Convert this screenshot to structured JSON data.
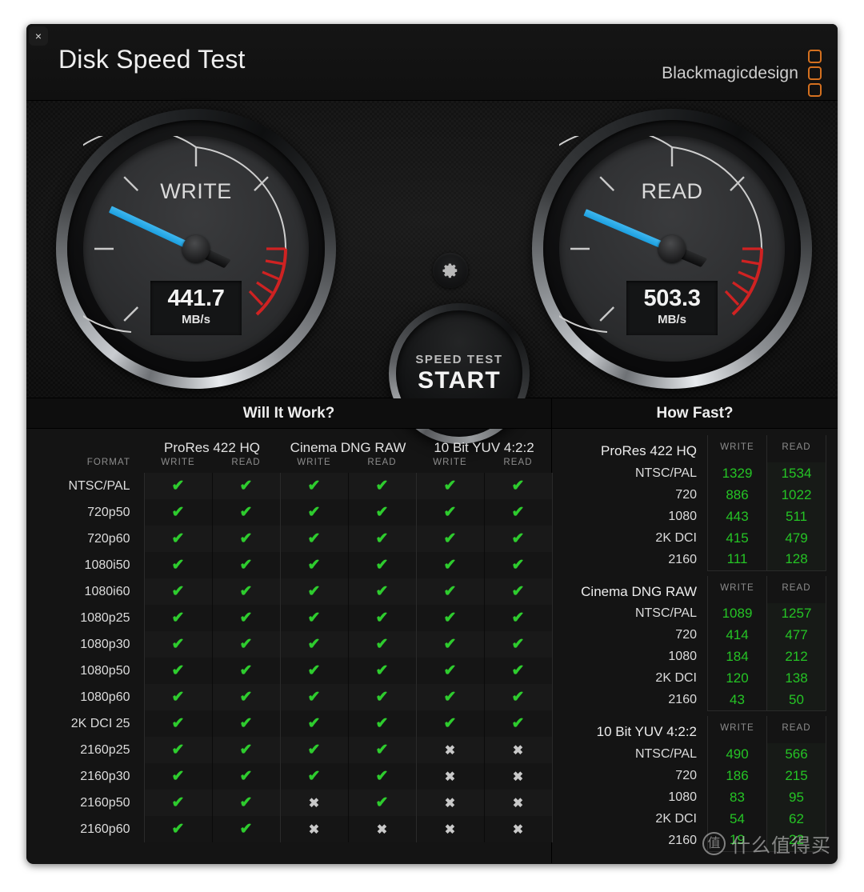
{
  "window": {
    "title": "Disk Speed Test",
    "close_label": "×"
  },
  "brand": {
    "text": "Blackmagicdesign",
    "mark_color": "#d4701f",
    "marks": 3
  },
  "gauges": {
    "write": {
      "label": "WRITE",
      "value": "441.7",
      "unit": "MB/s",
      "needle_angle": 205
    },
    "read": {
      "label": "READ",
      "value": "503.3",
      "unit": "MB/s",
      "needle_angle": 203
    },
    "accent_needle": "#2ba6e0",
    "redzone": "#cf2222"
  },
  "controls": {
    "gear_icon": "gear-icon",
    "start_sub": "SPEED TEST",
    "start_main": "START"
  },
  "will_it_work": {
    "title": "Will It Work?",
    "format_header": "FORMAT",
    "codecs": [
      "ProRes 422 HQ",
      "Cinema DNG RAW",
      "10 Bit YUV 4:2:2"
    ],
    "sub_headers": [
      "WRITE",
      "READ"
    ],
    "ok_glyph": "✔",
    "no_glyph": "✖",
    "rows": [
      {
        "format": "NTSC/PAL",
        "cells": [
          true,
          true,
          true,
          true,
          true,
          true
        ]
      },
      {
        "format": "720p50",
        "cells": [
          true,
          true,
          true,
          true,
          true,
          true
        ]
      },
      {
        "format": "720p60",
        "cells": [
          true,
          true,
          true,
          true,
          true,
          true
        ]
      },
      {
        "format": "1080i50",
        "cells": [
          true,
          true,
          true,
          true,
          true,
          true
        ]
      },
      {
        "format": "1080i60",
        "cells": [
          true,
          true,
          true,
          true,
          true,
          true
        ]
      },
      {
        "format": "1080p25",
        "cells": [
          true,
          true,
          true,
          true,
          true,
          true
        ]
      },
      {
        "format": "1080p30",
        "cells": [
          true,
          true,
          true,
          true,
          true,
          true
        ]
      },
      {
        "format": "1080p50",
        "cells": [
          true,
          true,
          true,
          true,
          true,
          true
        ]
      },
      {
        "format": "1080p60",
        "cells": [
          true,
          true,
          true,
          true,
          true,
          true
        ]
      },
      {
        "format": "2K DCI 25",
        "cells": [
          true,
          true,
          true,
          true,
          true,
          true
        ]
      },
      {
        "format": "2160p25",
        "cells": [
          true,
          true,
          true,
          true,
          false,
          false
        ]
      },
      {
        "format": "2160p30",
        "cells": [
          true,
          true,
          true,
          true,
          false,
          false
        ]
      },
      {
        "format": "2160p50",
        "cells": [
          true,
          true,
          false,
          true,
          false,
          false
        ]
      },
      {
        "format": "2160p60",
        "cells": [
          true,
          true,
          false,
          false,
          false,
          false
        ]
      }
    ]
  },
  "how_fast": {
    "title": "How Fast?",
    "sub_headers": [
      "WRITE",
      "READ"
    ],
    "value_color": "#25c425",
    "sections": [
      {
        "codec": "ProRes 422 HQ",
        "rows": [
          {
            "label": "NTSC/PAL",
            "write": "1329",
            "read": "1534"
          },
          {
            "label": "720",
            "write": "886",
            "read": "1022"
          },
          {
            "label": "1080",
            "write": "443",
            "read": "511"
          },
          {
            "label": "2K DCI",
            "write": "415",
            "read": "479"
          },
          {
            "label": "2160",
            "write": "111",
            "read": "128"
          }
        ]
      },
      {
        "codec": "Cinema DNG RAW",
        "rows": [
          {
            "label": "NTSC/PAL",
            "write": "1089",
            "read": "1257"
          },
          {
            "label": "720",
            "write": "414",
            "read": "477"
          },
          {
            "label": "1080",
            "write": "184",
            "read": "212"
          },
          {
            "label": "2K DCI",
            "write": "120",
            "read": "138"
          },
          {
            "label": "2160",
            "write": "43",
            "read": "50"
          }
        ]
      },
      {
        "codec": "10 Bit YUV 4:2:2",
        "rows": [
          {
            "label": "NTSC/PAL",
            "write": "490",
            "read": "566"
          },
          {
            "label": "720",
            "write": "186",
            "read": "215"
          },
          {
            "label": "1080",
            "write": "83",
            "read": "95"
          },
          {
            "label": "2K DCI",
            "write": "54",
            "read": "62"
          },
          {
            "label": "2160",
            "write": "19",
            "read": "22"
          }
        ]
      }
    ]
  },
  "watermark": {
    "badge": "值",
    "text": "什么值得买"
  }
}
